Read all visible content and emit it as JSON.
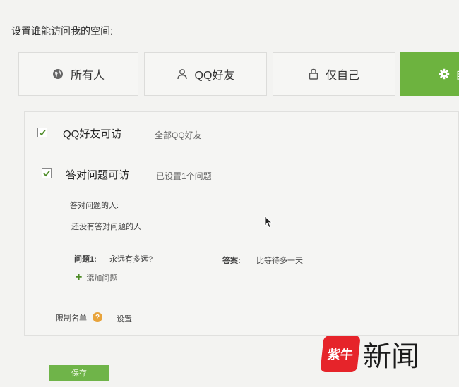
{
  "heading": "设置谁能访问我的空间:",
  "options": [
    {
      "label": "所有人",
      "icon": "globe-icon"
    },
    {
      "label": "QQ好友",
      "icon": "user-icon"
    },
    {
      "label": "仅自己",
      "icon": "lock-icon"
    },
    {
      "label": "自",
      "icon": "gear-icon",
      "active": true
    }
  ],
  "qq_friends": {
    "label": "QQ好友可访",
    "desc": "全部QQ好友"
  },
  "question_access": {
    "label": "答对问题可访",
    "desc": "已设置1个问题",
    "answered_title": "答对问题的人:",
    "answered_empty": "还没有答对问题的人",
    "question_label": "问题1:",
    "question_text": "永远有多远?",
    "answer_label": "答案:",
    "answer_text": "比等待多一天",
    "add_question": "添加问题"
  },
  "blocklist": {
    "label": "限制名单",
    "help": "?",
    "setting": "设置"
  },
  "save_label": "保存",
  "watermark": {
    "mark": "紫牛",
    "word": "新闻"
  },
  "colors": {
    "accent": "#6db33f",
    "help": "#e8a33a",
    "logo": "#e6242a"
  }
}
